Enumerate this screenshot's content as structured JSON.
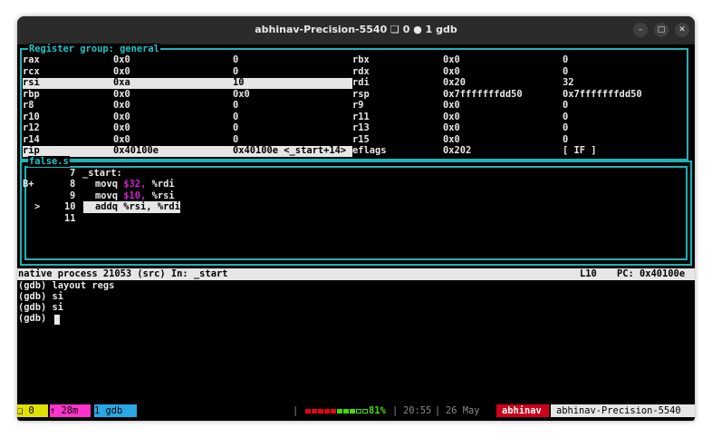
{
  "window": {
    "title": "abhinav-Precision-5540 ❑ 0 ● 1 gdb",
    "controls": [
      "–",
      "□",
      "✕"
    ]
  },
  "register_panel": {
    "title": "Register group: general",
    "rows": [
      {
        "n1": "rax",
        "v1": "0x0",
        "d1": "0",
        "n2": "rbx",
        "v2": "0x0",
        "d2": "0"
      },
      {
        "n1": "rcx",
        "v1": "0x0",
        "d1": "0",
        "n2": "rdx",
        "v2": "0x0",
        "d2": "0"
      },
      {
        "n1": "rsi",
        "v1": "0xa",
        "d1": "10",
        "n2": "rdi",
        "v2": "0x20",
        "d2": "32"
      },
      {
        "n1": "rbp",
        "v1": "0x0",
        "d1": "0x0",
        "n2": "rsp",
        "v2": "0x7fffffffdd50",
        "d2": "0x7fffffffdd50"
      },
      {
        "n1": "r8",
        "v1": "0x0",
        "d1": "0",
        "n2": "r9",
        "v2": "0x0",
        "d2": "0"
      },
      {
        "n1": "r10",
        "v1": "0x0",
        "d1": "0",
        "n2": "r11",
        "v2": "0x0",
        "d2": "0"
      },
      {
        "n1": "r12",
        "v1": "0x0",
        "d1": "0",
        "n2": "r13",
        "v2": "0x0",
        "d2": "0"
      },
      {
        "n1": "r14",
        "v1": "0x0",
        "d1": "0",
        "n2": "r15",
        "v2": "0x0",
        "d2": "0"
      },
      {
        "n1": "rip",
        "v1": "0x40100e",
        "d1": "0x40100e <_start+14>",
        "n2": "eflags",
        "v2": "0x202",
        "d2": "[ IF ]"
      }
    ]
  },
  "source_panel": {
    "title": "false.s",
    "lines": [
      {
        "marker": "",
        "num": "7",
        "label": "_start:",
        "op": "",
        "a1": "",
        "a1c": "",
        "a2": ""
      },
      {
        "marker": "B+",
        "num": "8",
        "label": "",
        "op": "movq ",
        "a1": "$32",
        "a1c": ",",
        "a2": " %rdi"
      },
      {
        "marker": "",
        "num": "9",
        "label": "",
        "op": "movq ",
        "a1": "$10",
        "a1c": ",",
        "a2": " %rsi"
      },
      {
        "marker": ">",
        "num": "10",
        "label": "",
        "op": "addq %rsi, %rdi",
        "a1": "",
        "a1c": "",
        "a2": ""
      },
      {
        "marker": "",
        "num": "11",
        "label": "",
        "op": "",
        "a1": "",
        "a1c": "",
        "a2": ""
      }
    ]
  },
  "gdb_status": {
    "left": "native process 21053 (src) In: _start",
    "line": "L10",
    "pc": "PC: 0x40100e"
  },
  "console": [
    "(gdb) layout regs",
    "(gdb) si",
    "(gdb) si",
    "(gdb) "
  ],
  "tmux": {
    "session": "❑ 0",
    "uptime": "↑ 28m",
    "window": "1 gdb",
    "battery_pct": 81,
    "battery_label": "81%",
    "time": "20:55",
    "date": "26 May",
    "user": "abhinav",
    "host": "abhinav-Precision-5540",
    "colors": {
      "session": "#e0e000",
      "uptime": "#ff33cc",
      "window": "#2aa8e6",
      "battery_low": "#e8001b",
      "battery_high": "#44dd00",
      "user": "#d0001a",
      "host": "#e6e6e6"
    }
  }
}
